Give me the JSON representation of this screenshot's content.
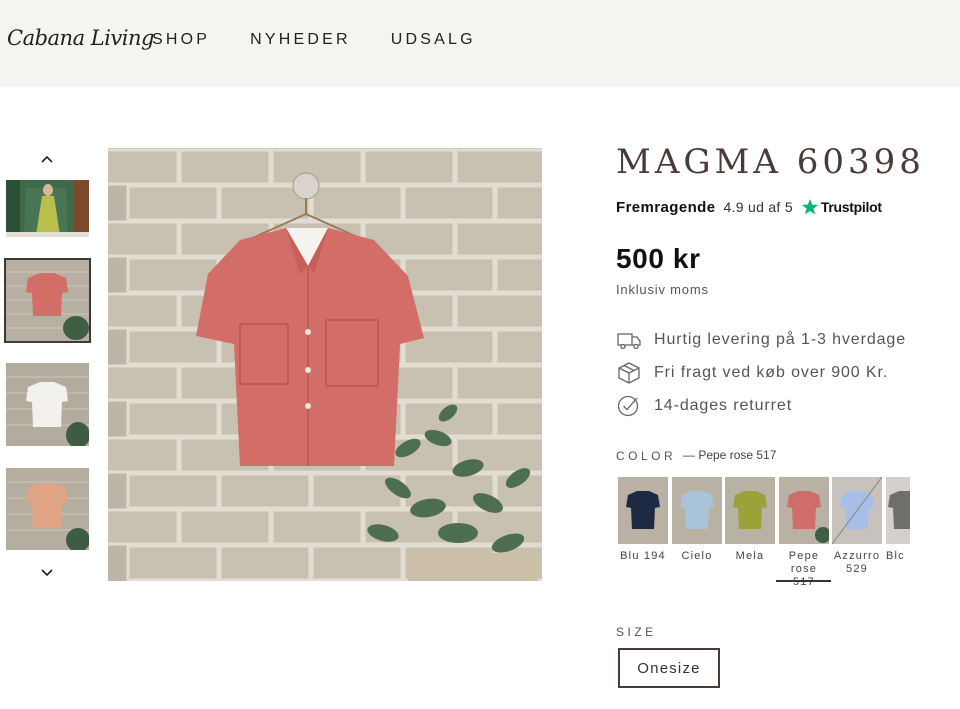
{
  "header": {
    "logo": "Cabana Living",
    "nav": [
      "SHOP",
      "NYHEDER",
      "UDSALG"
    ]
  },
  "gallery": {
    "thumbnails": [
      {
        "name": "green-dress"
      },
      {
        "name": "pink-shirt"
      },
      {
        "name": "white-shirt"
      },
      {
        "name": "peach-shirt"
      }
    ],
    "selected_index": 1
  },
  "product": {
    "title": "MAGMA 60398",
    "rating_word": "Fremragende",
    "rating_score": "4.9 ud af 5",
    "rating_brand": "Trustpilot",
    "price": "500 kr",
    "tax_note": "Inklusiv moms",
    "features": [
      {
        "icon": "truck-icon",
        "text": "Hurtig levering på 1-3 hverdage"
      },
      {
        "icon": "box-icon",
        "text": "Fri fragt ved køb over 900 Kr."
      },
      {
        "icon": "check-circle-icon",
        "text": "14-dages returret"
      }
    ],
    "color_label": "COLOR",
    "color_selected": "— Pepe rose 517",
    "swatches": [
      {
        "label": "Blu 194",
        "color": "#1e2a44"
      },
      {
        "label": "Cielo",
        "color": "#a9c3d8"
      },
      {
        "label": "Mela",
        "color": "#9ba23a"
      },
      {
        "label": "Pepe rose 517",
        "color": "#cf6d68"
      },
      {
        "label": "Azzurro 529",
        "color": "#a7bfe6"
      },
      {
        "label": "Blc",
        "color": "#6f6e6b"
      }
    ],
    "size_label": "SIZE",
    "size_value": "Onesize"
  },
  "colors": {
    "header_bg": "#f4f4f1",
    "title": "#4a3b38",
    "trustpilot_star": "#00b67a"
  }
}
